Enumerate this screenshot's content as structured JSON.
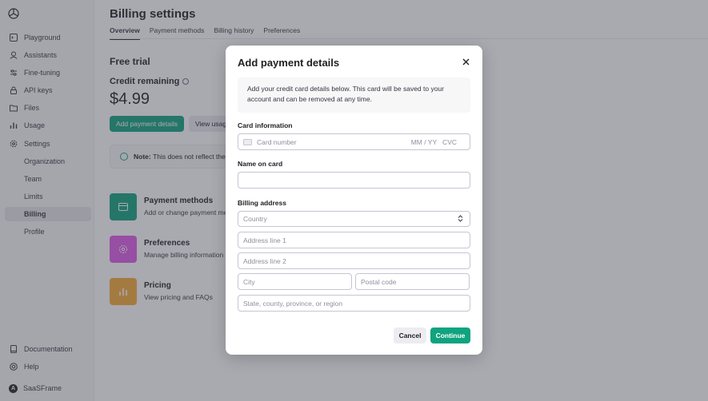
{
  "sidebar": {
    "items": [
      {
        "label": "Playground",
        "icon": "terminal-icon"
      },
      {
        "label": "Assistants",
        "icon": "robot-icon"
      },
      {
        "label": "Fine-tuning",
        "icon": "sliders-icon"
      },
      {
        "label": "API keys",
        "icon": "lock-icon"
      },
      {
        "label": "Files",
        "icon": "folder-icon"
      },
      {
        "label": "Usage",
        "icon": "bar-chart-icon"
      },
      {
        "label": "Settings",
        "icon": "gear-icon"
      }
    ],
    "sub_items": [
      "Organization",
      "Team",
      "Limits",
      "Billing",
      "Profile"
    ],
    "active": "Billing",
    "bottom": {
      "documentation": "Documentation",
      "help": "Help",
      "user_initial": "A",
      "user_name": "SaaSFrame"
    }
  },
  "main": {
    "title": "Billing settings",
    "tabs": [
      "Overview",
      "Payment methods",
      "Billing history",
      "Preferences"
    ],
    "active_tab": "Overview",
    "section_title": "Free trial",
    "credit_label": "Credit remaining",
    "credit_amount": "$4.99",
    "add_payment_label": "Add payment details",
    "view_usage_label": "View usage",
    "note_bold": "Note:",
    "note_text": "This does not reflect the",
    "cards": [
      {
        "title": "Payment methods",
        "subtitle": "Add or change payment methods",
        "color": "#10a37f",
        "icon": "credit-card-icon"
      },
      {
        "title": "Preferences",
        "subtitle": "Manage billing information",
        "color": "#dd5ce5",
        "icon": "gear-icon"
      },
      {
        "title": "Pricing",
        "subtitle": "View pricing and FAQs",
        "color": "#f4ac36",
        "icon": "bar-chart-icon"
      }
    ]
  },
  "modal": {
    "title": "Add payment details",
    "info": "Add your credit card details below. This card will be saved to your account and can be removed at any time.",
    "card_info_label": "Card information",
    "card_number_placeholder": "Card number",
    "card_expiry_cvc": "MM / YY   CVC",
    "name_label": "Name on card",
    "name_value": "",
    "billing_label": "Billing address",
    "country_placeholder": "Country",
    "address1_placeholder": "Address line 1",
    "address2_placeholder": "Address line 2",
    "city_placeholder": "City",
    "postal_placeholder": "Postal code",
    "state_placeholder": "State, county, province, or region",
    "cancel_label": "Cancel",
    "continue_label": "Continue"
  },
  "colors": {
    "accent": "#10a37f"
  }
}
